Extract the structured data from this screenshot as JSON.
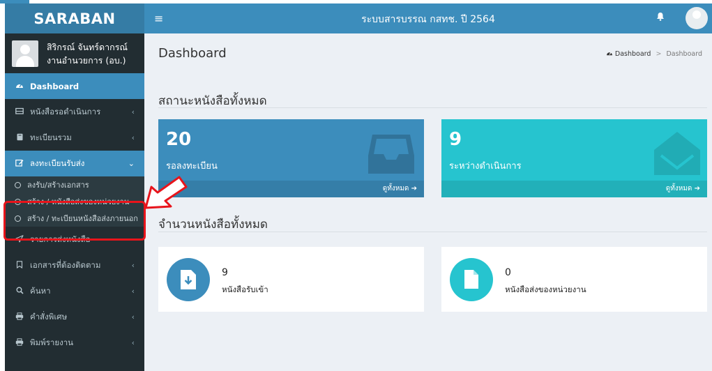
{
  "app": {
    "brand": "SARABAN",
    "title": "ระบบสารบรรณ กสทช. ปี 2564"
  },
  "user": {
    "name": "สิริกรณ์ จันทร์ดากรณ์",
    "department": "งานอำนวยการ (อบ.)"
  },
  "sidebar": {
    "items": [
      {
        "label": "Dashboard",
        "icon": "dashboard-icon"
      },
      {
        "label": "หนังสือรอดำเนินการ",
        "icon": "inbox-icon"
      },
      {
        "label": "ทะเบียนรวม",
        "icon": "book-icon"
      },
      {
        "label": "ลงทะเบียนรับส่ง",
        "icon": "edit-icon"
      },
      {
        "label": "รายการส่งหนังสือ",
        "icon": "send-icon"
      },
      {
        "label": "เอกสารที่ต้องติดตาม",
        "icon": "bookmark-icon"
      },
      {
        "label": "ค้นหา",
        "icon": "search-icon"
      },
      {
        "label": "คำสั่งพิเศษ",
        "icon": "print-icon"
      },
      {
        "label": "พิมพ์รายงาน",
        "icon": "print-icon"
      }
    ],
    "submenu": [
      {
        "label": "ลงรับ/สร้างเอกสาร"
      },
      {
        "label": "สร้าง / หนังสือส่งของหน่วยงาน"
      },
      {
        "label": "สร้าง / ทะเบียนหนังสือส่งภายนอก"
      }
    ]
  },
  "page": {
    "title": "Dashboard",
    "breadcrumb": {
      "home": "Dashboard",
      "separator": ">",
      "current": "Dashboard"
    },
    "section_all": "สถานะหนังสือทั้งหมด",
    "section_count": "จำนวนหนังสือทั้งหมด"
  },
  "status_boxes": [
    {
      "value": "20",
      "label": "รอลงทะเบียน",
      "footer": "ดูทั้งหมด",
      "color": "#3c8dbc"
    },
    {
      "value": "9",
      "label": "ระหว่างดำเนินการ",
      "footer": "ดูทั้งหมด",
      "color": "#26c4cf"
    }
  ],
  "info_boxes": [
    {
      "value": "9",
      "label": "หนังสือรับเข้า",
      "color": "#3c8dbc"
    },
    {
      "value": "0",
      "label": "หนังสือส่งของหน่วยงาน",
      "color": "#26c4cf"
    }
  ],
  "colors": {
    "accent": "#3c8dbc",
    "sidebar": "#222d32",
    "annotation": "#e8141b"
  }
}
